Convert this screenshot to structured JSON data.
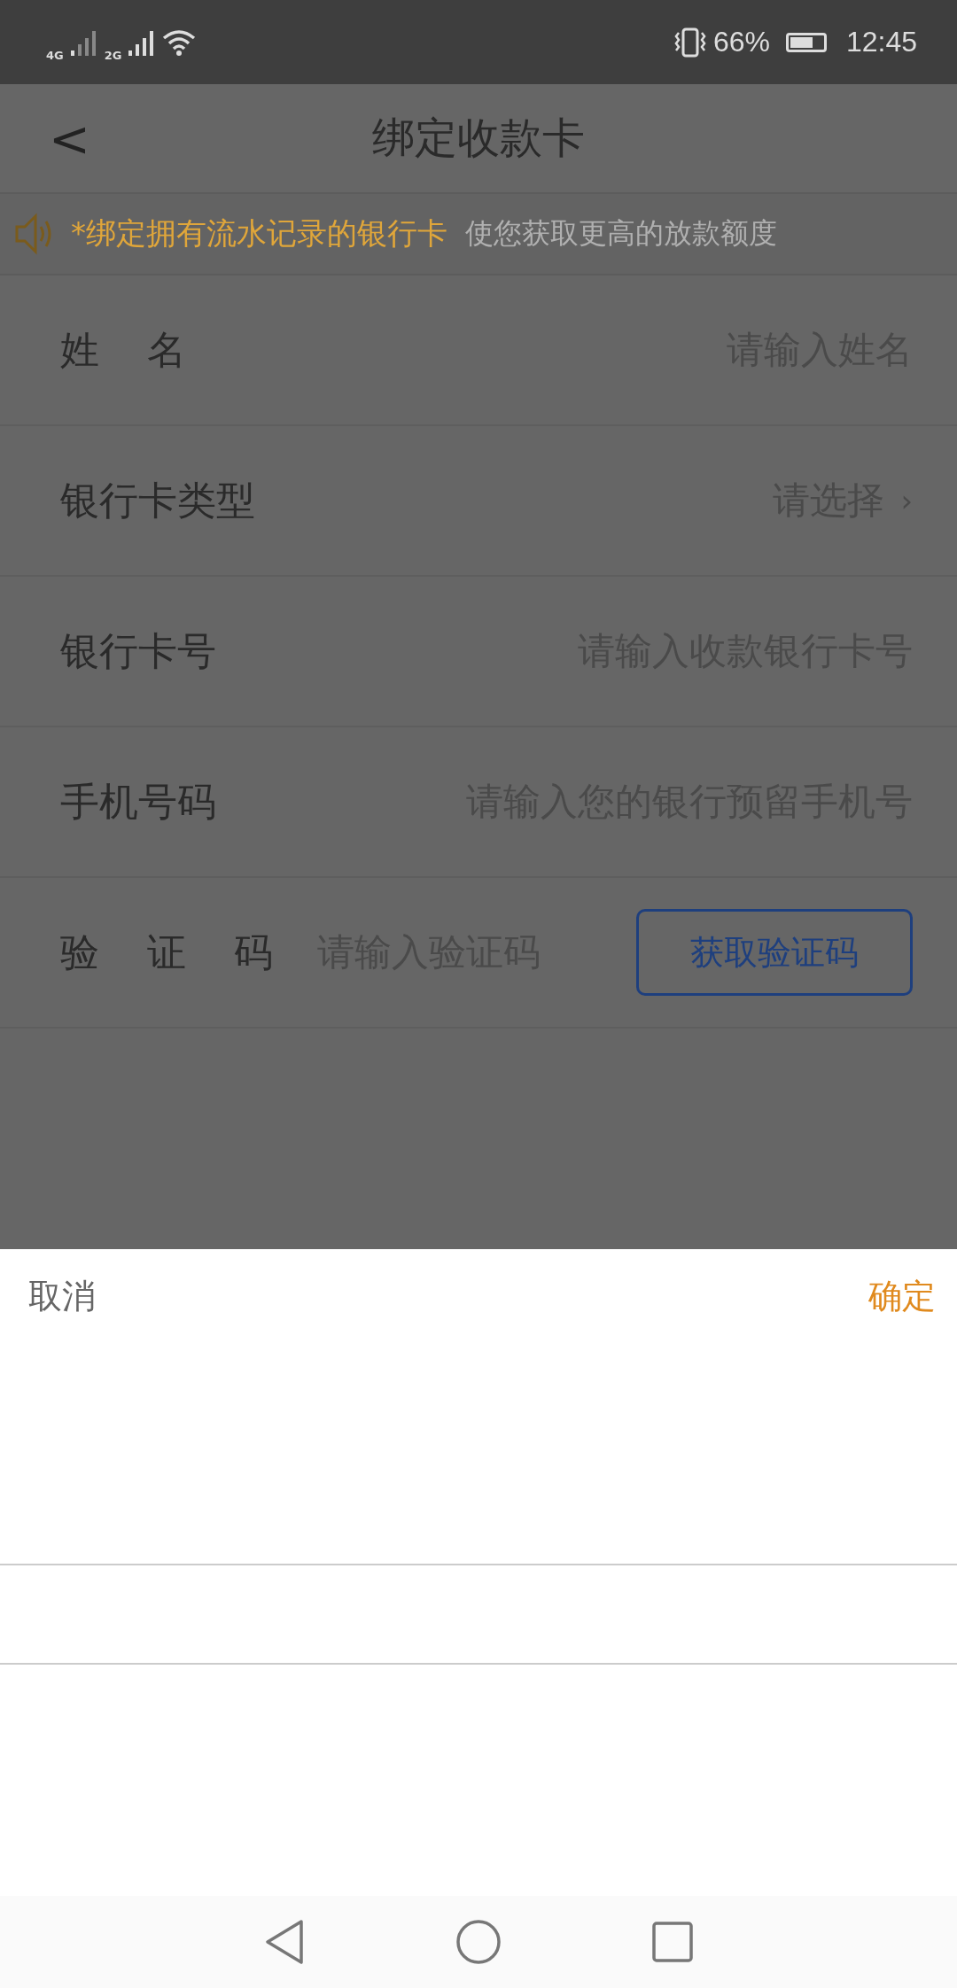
{
  "status_bar": {
    "network_1": "4G",
    "network_2": "2G",
    "battery_percent": "66%",
    "time": "12:45"
  },
  "header": {
    "back": "<",
    "title": "绑定收款卡"
  },
  "notice": {
    "highlight": "*绑定拥有流水记录的银行卡",
    "text": "使您获取更高的放款额度"
  },
  "form": [
    {
      "kind": "input",
      "label": "姓 名",
      "placeholder": "请输入姓名"
    },
    {
      "kind": "select",
      "label": "银行卡类型",
      "placeholder": "请选择",
      "chevron": "›"
    },
    {
      "kind": "input",
      "label": "银行卡号",
      "placeholder": "请输入收款银行卡号"
    },
    {
      "kind": "input",
      "label": "手机号码",
      "placeholder": "请输入您的银行预留手机号"
    },
    {
      "kind": "code",
      "label": "验 证 码",
      "placeholder": "请输入验证码",
      "button": "获取验证码"
    }
  ],
  "picker": {
    "cancel": "取消",
    "confirm": "确定"
  }
}
